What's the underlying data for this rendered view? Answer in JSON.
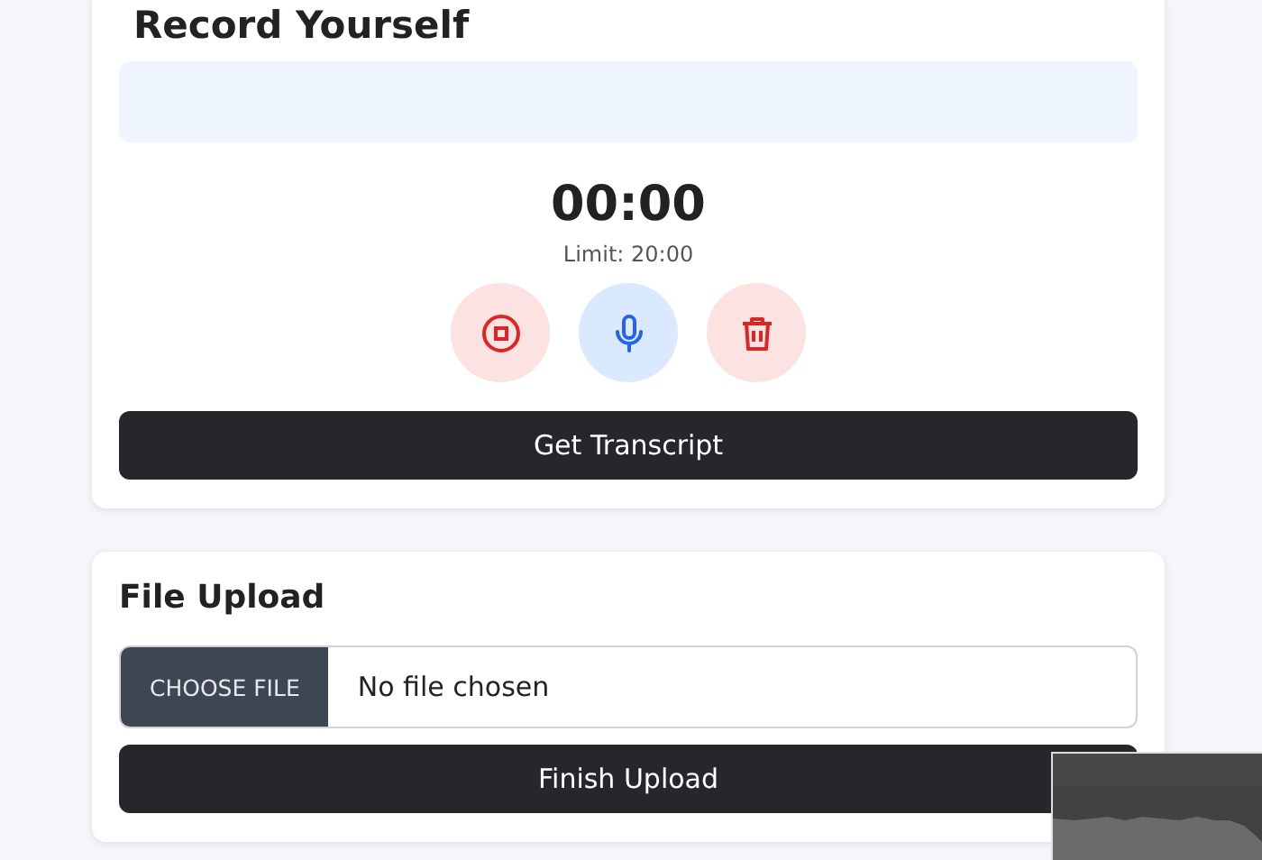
{
  "record": {
    "title": "Record Yourself",
    "timer": "00:00",
    "limit": "Limit: 20:00",
    "transcript_button": "Get Transcript"
  },
  "controls": [
    {
      "kind": "stop"
    },
    {
      "kind": "mic"
    },
    {
      "kind": "delete"
    }
  ],
  "upload": {
    "title": "File Upload",
    "choose_button": "CHOOSE FILE",
    "file_status": "No file chosen",
    "finish_button": "Finish Upload"
  }
}
